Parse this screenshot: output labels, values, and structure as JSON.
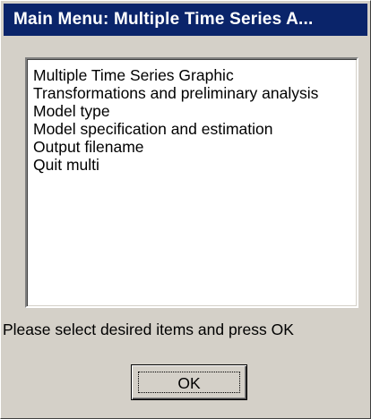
{
  "window": {
    "title": "Main Menu: Multiple Time Series A..."
  },
  "menu": {
    "items": [
      "Multiple Time Series Graphic",
      "Transformations and preliminary analysis",
      "Model type",
      "Model specification and estimation",
      "Output filename",
      "Quit multi"
    ]
  },
  "prompt": "Please select desired items and press OK",
  "buttons": {
    "ok_label": "OK"
  },
  "colors": {
    "titlebar": "#0a246a",
    "window_face": "#d4d0c8"
  }
}
